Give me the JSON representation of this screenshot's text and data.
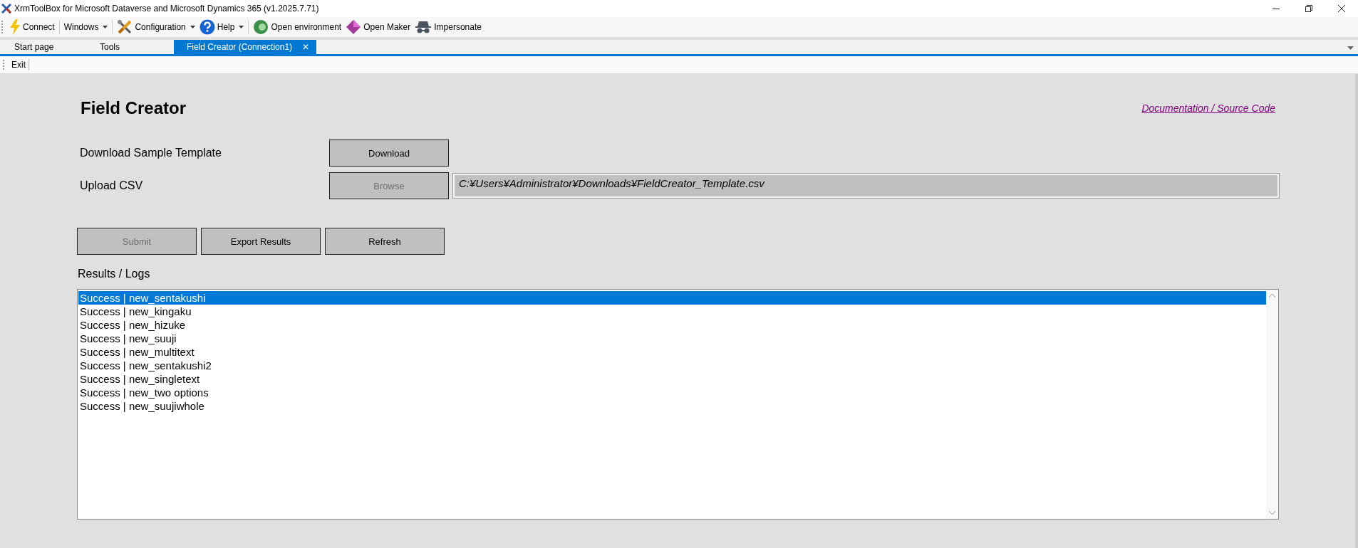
{
  "window": {
    "title": "XrmToolBox for Microsoft Dataverse and Microsoft Dynamics 365 (v1.2025.7.71)"
  },
  "toolbar": [
    {
      "label": "Connect",
      "dropdown": false
    },
    {
      "label": "Windows",
      "dropdown": true
    },
    {
      "label": "Configuration",
      "dropdown": true
    },
    {
      "label": "Help",
      "dropdown": true
    },
    {
      "label": "Open environment",
      "dropdown": false
    },
    {
      "label": "Open Maker",
      "dropdown": false
    },
    {
      "label": "Impersonate",
      "dropdown": false
    }
  ],
  "tabs": [
    {
      "label": "Start page",
      "selected": false,
      "closable": false
    },
    {
      "label": "Tools",
      "selected": false,
      "closable": false
    },
    {
      "label": "Field Creator (Connection1)",
      "selected": true,
      "closable": true
    }
  ],
  "tab_close": "✕",
  "plugin_toolbar": [
    {
      "label": "Exit"
    }
  ],
  "heading": "Field Creator",
  "link": "Documentation / Source Code",
  "download_row": {
    "label": "Download Sample Template",
    "button": {
      "label": "Download",
      "disabled": false
    }
  },
  "upload_row": {
    "label": "Upload CSV",
    "button": {
      "label": "Browse",
      "disabled": true
    },
    "path": "C:¥Users¥Administrator¥Downloads¥FieldCreator_Template.csv"
  },
  "actions": [
    {
      "label": "Submit",
      "disabled": true
    },
    {
      "label": "Export Results",
      "disabled": false
    },
    {
      "label": "Refresh",
      "disabled": false
    }
  ],
  "results_label": "Results / Logs",
  "logs": [
    {
      "text": "Success | new_sentakushi",
      "selected": true
    },
    {
      "text": "Success | new_kingaku",
      "selected": false
    },
    {
      "text": "Success | new_hizuke",
      "selected": false
    },
    {
      "text": "Success | new_suuji",
      "selected": false
    },
    {
      "text": "Success | new_multitext",
      "selected": false
    },
    {
      "text": "Success | new_sentakushi2",
      "selected": false
    },
    {
      "text": "Success | new_singletext",
      "selected": false
    },
    {
      "text": "Success | new_two options",
      "selected": false
    },
    {
      "text": "Success | new_suujiwhole",
      "selected": false
    }
  ]
}
